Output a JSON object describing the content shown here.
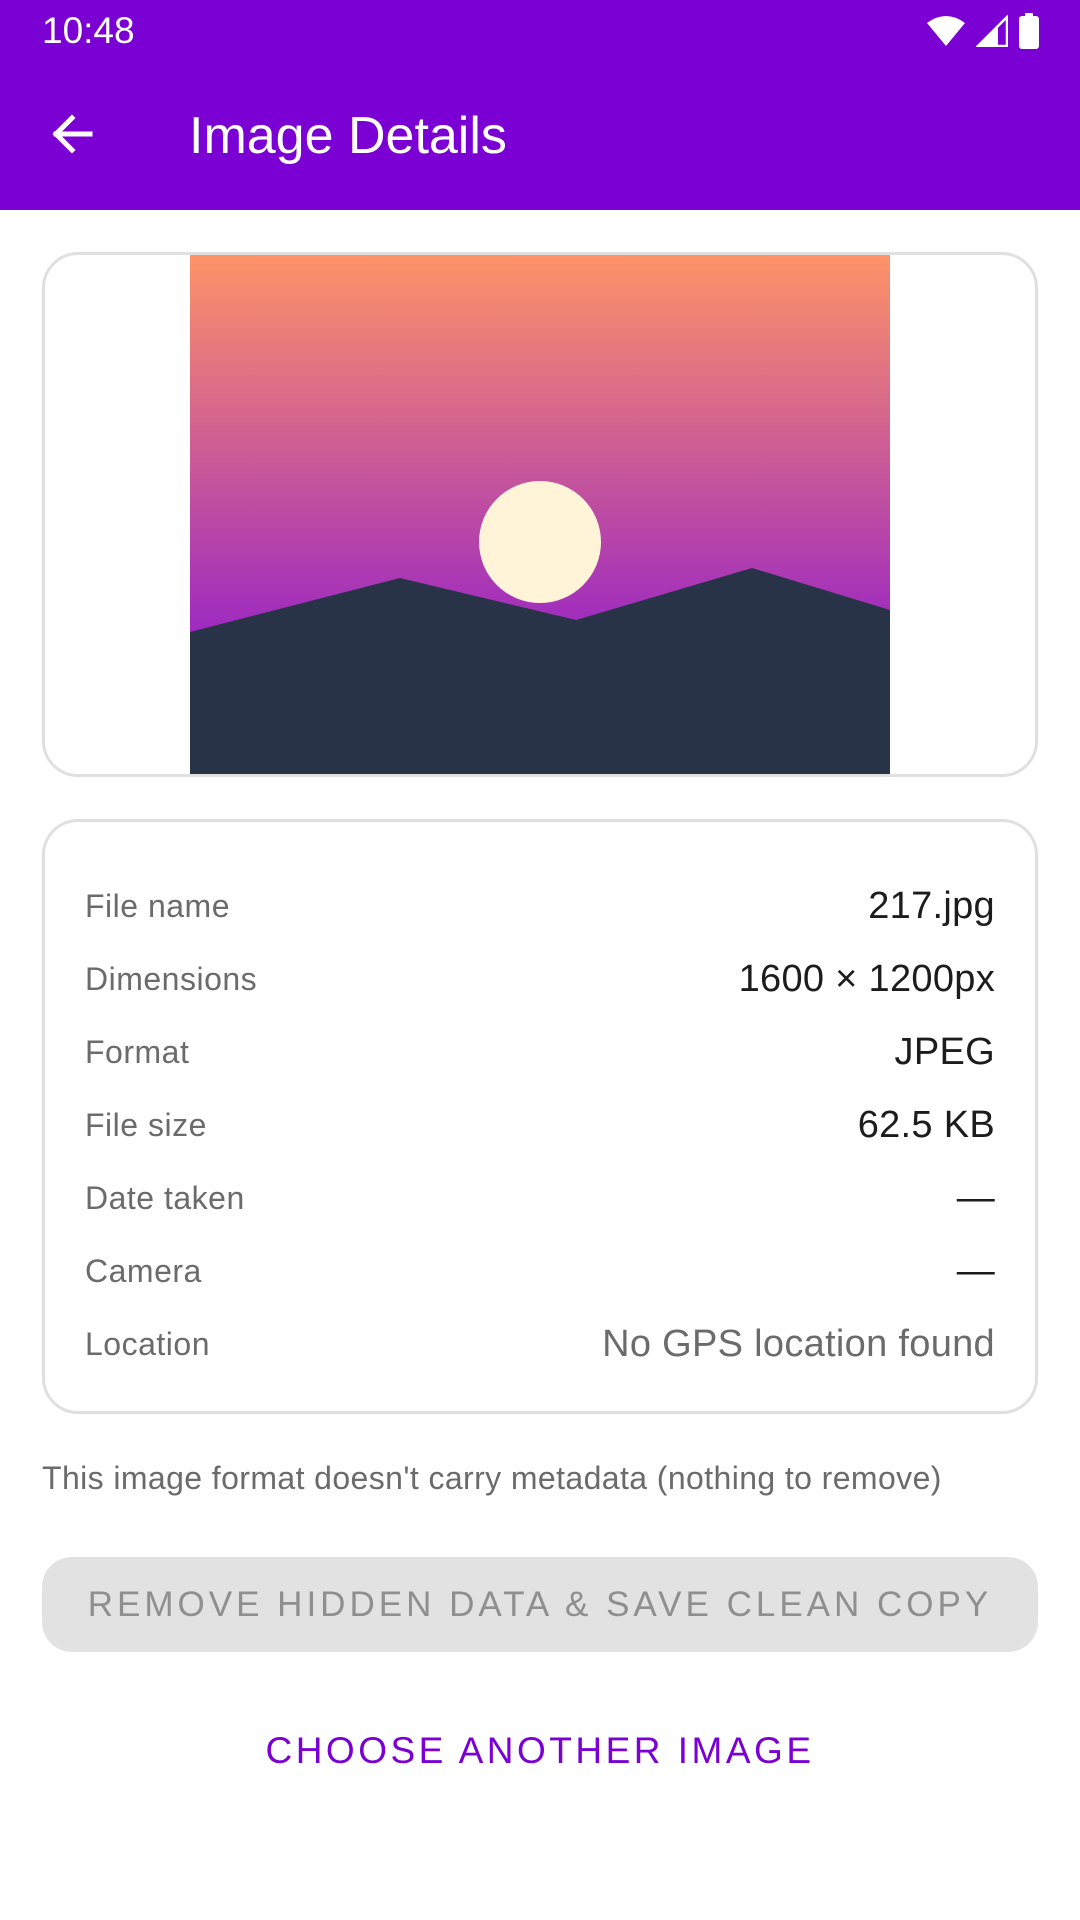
{
  "status_bar": {
    "time": "10:48",
    "icons": [
      "wifi-icon",
      "cell-signal-icon",
      "battery-icon"
    ]
  },
  "app_bar": {
    "title": "Image Details",
    "back_icon": "arrow-back-icon",
    "color": "#7b00d4"
  },
  "preview": {
    "icon": "landscape-placeholder-image",
    "colors": {
      "sky_top": "#ff9467",
      "sky_bottom": "#9b27c2",
      "sun": "#fff4d8",
      "mountains": "#283347"
    }
  },
  "details": {
    "rows": [
      {
        "label": "File name",
        "value": "217.jpg"
      },
      {
        "label": "Dimensions",
        "value": "1600 × 1200px"
      },
      {
        "label": "Format",
        "value": "JPEG"
      },
      {
        "label": "File size",
        "value": "62.5 KB"
      },
      {
        "label": "Date taken",
        "value": "—"
      },
      {
        "label": "Camera",
        "value": "—"
      },
      {
        "label": "Location",
        "value": "No GPS location found"
      }
    ]
  },
  "note": "This image format doesn't carry metadata (nothing to remove)",
  "actions": {
    "remove_label": "REMOVE HIDDEN DATA & SAVE CLEAN COPY",
    "remove_enabled": false,
    "choose_label": "CHOOSE ANOTHER IMAGE"
  }
}
